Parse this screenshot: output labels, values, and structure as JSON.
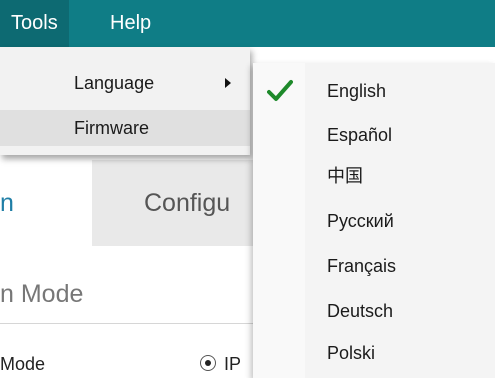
{
  "menubar": {
    "items": [
      {
        "label": "Tools",
        "active": true
      },
      {
        "label": "Help",
        "active": false
      }
    ]
  },
  "tools_menu": {
    "items": [
      {
        "label": "Language",
        "has_submenu": true
      },
      {
        "label": "Firmware",
        "has_submenu": false
      }
    ]
  },
  "language_menu": {
    "items": [
      {
        "label": "English",
        "checked": true
      },
      {
        "label": "Español",
        "checked": false
      },
      {
        "label": "中国",
        "checked": false
      },
      {
        "label": "Русский",
        "checked": false
      },
      {
        "label": "Français",
        "checked": false
      },
      {
        "label": "Deutsch",
        "checked": false
      },
      {
        "label": "Polski",
        "checked": false
      }
    ],
    "check_icon": "checkmark-icon",
    "check_color": "#1e8a2b"
  },
  "background": {
    "tab_left_fragment": "n",
    "tab_configure_fragment": "Configu",
    "mode_heading_fragment": "n Mode",
    "mode_label": "Mode",
    "radio_label_fragment": "IP"
  },
  "colors": {
    "menubar_bg": "#0f7d86",
    "link_blue": "#1f7ea6"
  }
}
